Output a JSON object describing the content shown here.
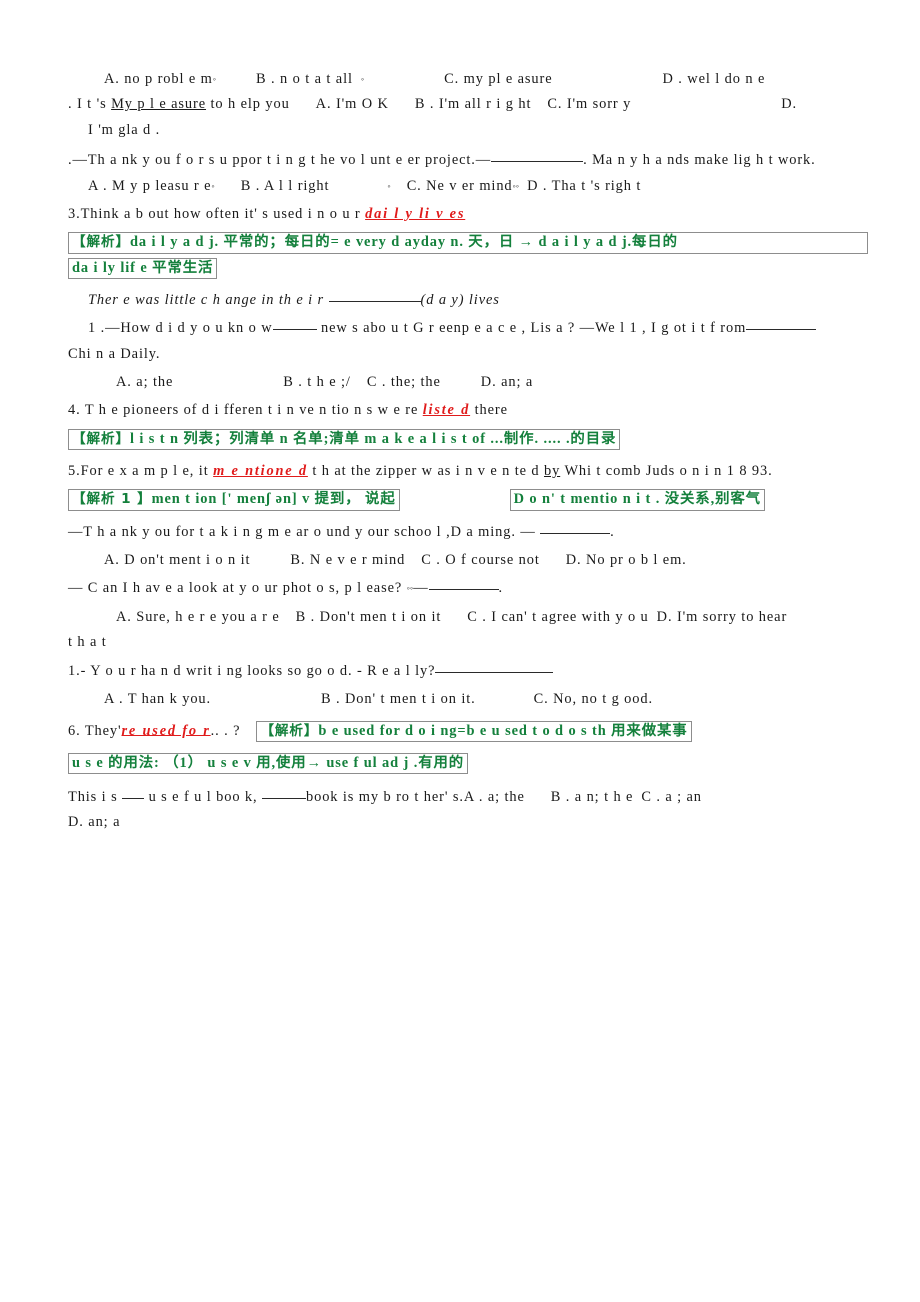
{
  "document": {
    "type": "english-exam-worksheet-with-annotations",
    "colors": {
      "analysis_green": "#14803c",
      "highlight_red": "#e01b1b",
      "box_border": "#8d8d8d",
      "body_text": "#1a1a1a",
      "page_background": "#ffffff"
    }
  },
  "lines": {
    "l1_optA": "A.  no p robl e m",
    "l1_optB": "B . n o t  a t  all",
    "l1_optC": "C. my   pl e asure",
    "l1_optD": "D . wel l  do n e",
    "l2_a": ". I t 's ",
    "l2_under": "My p l e asure",
    "l2_b": " to  h elp you",
    "l2_optA": "A. I'm O K",
    "l2_optB": "B . I'm all   r i g ht",
    "l2_optC": "C.   I'm   sorr y",
    "l2_optD": "D.",
    "l3": "I 'm gla d .",
    "l4_a": ".—Th a nk   y ou f o r s u ppor t i n g  t he   vo l unt e er project.—",
    "l4_b": ". Ma n y h a nds make lig h t work.",
    "l5_optA": "A . M y  p leasu r e",
    "l5_optB": "B . A l l  right",
    "l5_optC": "C.  Ne v er mind",
    "l5_optD": "D .    Tha t 's   righ t",
    "l6_a": "3.Think   a b out   how often   it' s  used  i n o u r ",
    "l6_red": "dai l y li v es",
    "ana1_label": "【解析】",
    "ana1_text": "da i l y   a d j.    平常的；每日的=   e very d ayday  n. 天，日 → d a i l y   a d j.每日的",
    "ana1_b": "da i ly lif e 平常生活",
    "l7_a": "Ther e  was little   c h ange in th e  i r ",
    "l7_b": "(d a y) lives",
    "l8_a": "1 .—How d i d  y o u kn o w",
    "l8_b": " new s  abo u t   G r eenp e a c e , Lis a ? —We l 1 , I  g ot  i t  f rom",
    "l9": "Chi n a Daily.",
    "l10_optA": "A.   a; the",
    "l10_optB": "B .  t h e ;/",
    "l10_optC": "C .     the;   the",
    "l10_optD": "D. an; a",
    "l11_a": "4.  T h e pioneers of d i fferen t    i n ve n tio n s  w e re ",
    "l11_red": "liste d",
    "l11_b": "  there",
    "ana2_label": "【解析】",
    "ana2_text": "l i s t  n 列表；列清单 n 名单;清单   m a k e a l i s t   of ...制作. .... .的目录",
    "l12_a": "5.For  e  x  a m p  l e, it ",
    "l12_red": "m e ntione d",
    "l12_b": " t h at the zipper w as   i n v e n te d ",
    "l12_under": "by",
    "l12_c": " Whi t comb Juds o n i n  1 8 93.",
    "ana3_label": "【解析 1 】",
    "ana3_text": "men t ion  [' menʃ ən]     v 提到， 说起",
    "ana4_text": "D o n' t mentio n i t .  没关系,别客气",
    "l13": "—T h a nk y ou for t a k i  n g m e ar o und y our   schoo l ,D a ming.  — ",
    "l13_end": ".",
    "l14_optA": "A. D on't ment i o n it",
    "l14_optB": "B.     N e v e r mind",
    "l14_optC": "C . O f course not",
    "l14_optD": "D. No   pr o b l em.",
    "l15": "—   C an   I h av e  a  look at   y o ur phot o s,   p l ease? ",
    "l16_optA": "A. Sure, h e r e  you a r e",
    "l16_optB": "B . Don't men t  i on it",
    "l16_optC": "C . I can' t  agree with   y o u",
    "l16_optD": "D. I'm   sorry   to hear",
    "l17": "t h a t",
    "l18": "1.- Y o u r   ha n d writ i ng looks so go o d.  - R e a  l ly?",
    "l19_optA": "A .     T han k  you.",
    "l19_optB": "B . Don' t   men t  i on it.",
    "l19_optC": "C. No, no t  g ood.",
    "l20_a": "6. They'",
    "l20_red": "re used   fo r",
    "l20_b": ".. . ?",
    "ana5_label": "【解析】",
    "ana5_text": "b e used for   d o i ng=b e   u sed  t o d o  s th    用来做某事",
    "ana6_text": "u s e 的用法:  （1） u s e v 用,使用→  use f ul ad j .有用的",
    "l21_a": "This  i s ",
    "l21_b": " u s e f u l  boo k,  ",
    "l21_c": "book is my  b ro t her' s.",
    "l21_optA": "A .  a; the",
    "l21_optB": "B .    a n; t h e",
    "l21_optC": "C . a ; an",
    "l22_optD": "D.  an;  a"
  }
}
